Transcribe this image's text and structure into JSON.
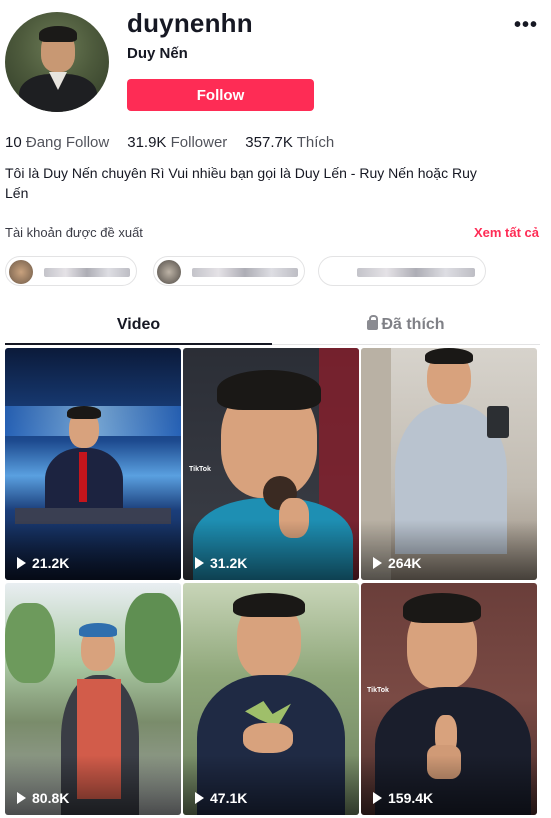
{
  "profile": {
    "username": "duynenhn",
    "nickname": "Duy Nến",
    "follow_label": "Follow",
    "more_label": "•••",
    "stats": [
      {
        "value": "10",
        "label": "Đang Follow"
      },
      {
        "value": "31.9K",
        "label": "Follower"
      },
      {
        "value": "357.7K",
        "label": "Thích"
      }
    ],
    "bio": "Tôi là Duy Nến chuyên Rì Vui nhiều bạn gọi là Duy Lến - Ruy Nến hoặc Ruy Lến"
  },
  "suggested": {
    "title": "Tài khoản được đề xuất",
    "see_all": "Xem tất cả"
  },
  "tabs": {
    "video": "Video",
    "liked": "Đã thích"
  },
  "videos": [
    {
      "views": "21.2K"
    },
    {
      "views": "31.2K"
    },
    {
      "views": "264K"
    },
    {
      "views": "80.8K"
    },
    {
      "views": "47.1K"
    },
    {
      "views": "159.4K"
    }
  ],
  "watermark": "TikTok",
  "colors": {
    "accent": "#fe2c55",
    "text": "#161823"
  }
}
